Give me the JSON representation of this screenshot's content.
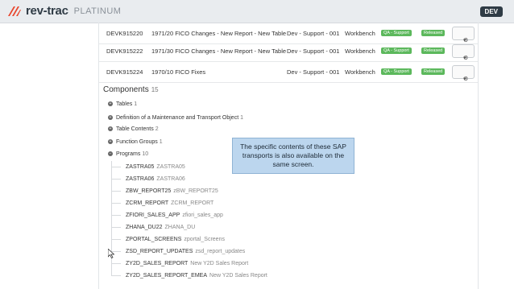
{
  "header": {
    "brand": "rev-trac",
    "edition": "PLATINUM",
    "env_badge": "DEV"
  },
  "transports": [
    {
      "id": "DEVK915220",
      "description": "1971/20 FICO Changes - New Report - New Table",
      "stage": "Dev - Support - 001",
      "type": "Workbench",
      "qa_badge": "QA - Support",
      "status_badge": "Released"
    },
    {
      "id": "DEVK915222",
      "description": "1971/30 FICO Changes - New Report - New Table",
      "stage": "Dev - Support - 001",
      "type": "Workbench",
      "qa_badge": "QA - Support",
      "status_badge": "Released"
    },
    {
      "id": "DEVK915224",
      "description": "1970/10 FICO Fixes",
      "stage": "Dev - Support - 001",
      "type": "Workbench",
      "qa_badge": "QA - Support",
      "status_badge": "Released"
    }
  ],
  "components": {
    "title": "Components",
    "count": "15",
    "groups": [
      {
        "label": "Tables",
        "count": "1"
      },
      {
        "label": "Definition of a Maintenance and Transport Object",
        "count": "1"
      },
      {
        "label": "Table Contents",
        "count": "2"
      },
      {
        "label": "Function Groups",
        "count": "1"
      },
      {
        "label": "Programs",
        "count": "10"
      }
    ],
    "programs": [
      {
        "name": "ZASTRA05",
        "desc": "ZASTRA05"
      },
      {
        "name": "ZASTRA06",
        "desc": "ZASTRA06"
      },
      {
        "name": "ZBW_REPORT25",
        "desc": "zBW_REPORT25"
      },
      {
        "name": "ZCRM_REPORT",
        "desc": "ZCRM_REPORT"
      },
      {
        "name": "ZFIORI_SALES_APP",
        "desc": "zfiori_sales_app"
      },
      {
        "name": "ZHANA_DU22",
        "desc": "ZHANA_DU"
      },
      {
        "name": "ZPORTAL_SCREENS",
        "desc": "zportal_Screens"
      },
      {
        "name": "ZSD_REPORT_UPDATES",
        "desc": "zsd_report_updates"
      },
      {
        "name": "ZY2D_SALES_REPORT",
        "desc": "New Y2D Sales Report"
      },
      {
        "name": "ZY2D_SALES_REPORT_EMEA",
        "desc": "New Y2D Sales Report"
      }
    ]
  },
  "callout": {
    "text": "The specific contents of these SAP transports is also available on the same screen."
  }
}
